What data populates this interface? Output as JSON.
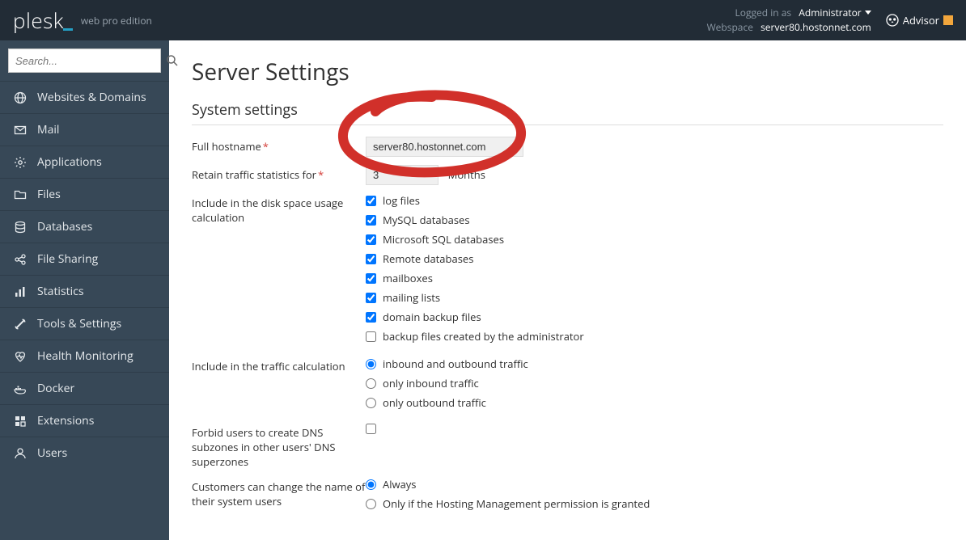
{
  "header": {
    "logo": "plesk",
    "edition": "web pro edition",
    "logged_in_label": "Logged in as",
    "logged_in_user": "Administrator",
    "webspace_label": "Webspace",
    "webspace_value": "server80.hostonnet.com",
    "advisor_label": "Advisor"
  },
  "search": {
    "placeholder": "Search..."
  },
  "nav": [
    {
      "label": "Websites & Domains",
      "icon": "globe-icon"
    },
    {
      "label": "Mail",
      "icon": "mail-icon"
    },
    {
      "label": "Applications",
      "icon": "gear-icon"
    },
    {
      "label": "Files",
      "icon": "folder-icon"
    },
    {
      "label": "Databases",
      "icon": "database-icon"
    },
    {
      "label": "File Sharing",
      "icon": "share-icon"
    },
    {
      "label": "Statistics",
      "icon": "stats-icon"
    },
    {
      "label": "Tools & Settings",
      "icon": "tools-icon"
    },
    {
      "label": "Health Monitoring",
      "icon": "health-icon"
    },
    {
      "label": "Docker",
      "icon": "docker-icon"
    },
    {
      "label": "Extensions",
      "icon": "extensions-icon"
    },
    {
      "label": "Users",
      "icon": "users-icon"
    }
  ],
  "page": {
    "title": "Server Settings",
    "section": "System settings",
    "hostname_label": "Full hostname",
    "hostname_value": "server80.hostonnet.com",
    "retain_label": "Retain traffic statistics for",
    "retain_value": "3",
    "retain_unit": "Months",
    "disk_label": "Include in the disk space usage calculation",
    "disk_opts": [
      {
        "label": "log files",
        "checked": true
      },
      {
        "label": "MySQL databases",
        "checked": true
      },
      {
        "label": "Microsoft SQL databases",
        "checked": true
      },
      {
        "label": "Remote databases",
        "checked": true
      },
      {
        "label": "mailboxes",
        "checked": true
      },
      {
        "label": "mailing lists",
        "checked": true
      },
      {
        "label": "domain backup files",
        "checked": true
      },
      {
        "label": "backup files created by the administrator",
        "checked": false
      }
    ],
    "traffic_label": "Include in the traffic calculation",
    "traffic_opts": [
      {
        "label": "inbound and outbound traffic",
        "checked": true
      },
      {
        "label": "only inbound traffic",
        "checked": false
      },
      {
        "label": "only outbound traffic",
        "checked": false
      }
    ],
    "forbid_label": "Forbid users to create DNS subzones in other users' DNS superzones",
    "forbid_checked": false,
    "rename_label": "Customers can change the name of their system users",
    "rename_opts": [
      {
        "label": "Always",
        "checked": true
      },
      {
        "label": "Only if the Hosting Management permission is granted",
        "checked": false
      }
    ]
  }
}
